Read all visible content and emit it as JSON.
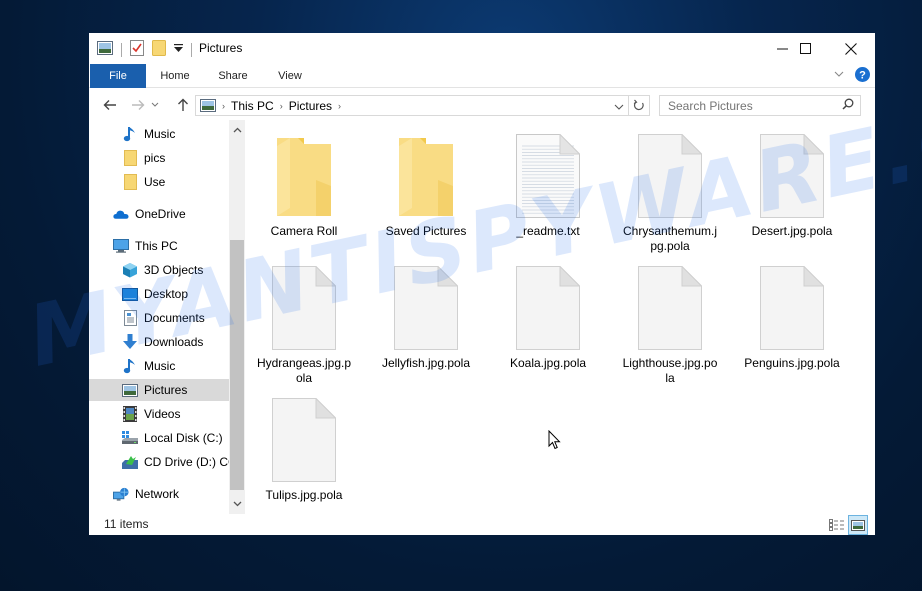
{
  "window": {
    "title": "Pictures",
    "controls": {
      "minimize": "minimize",
      "maximize": "maximize",
      "close": "close"
    }
  },
  "ribbon": {
    "tabs": [
      {
        "label": "File",
        "active": true
      },
      {
        "label": "Home"
      },
      {
        "label": "Share"
      },
      {
        "label": "View"
      }
    ]
  },
  "navbar": {
    "breadcrumb": [
      "This PC",
      "Pictures"
    ],
    "search_placeholder": "Search Pictures"
  },
  "sidebar": {
    "items": [
      {
        "label": "Music",
        "icon": "music-icon",
        "indent": 2
      },
      {
        "label": "pics",
        "icon": "folder-icon",
        "indent": 2
      },
      {
        "label": "Use",
        "icon": "folder-icon",
        "indent": 2
      },
      {
        "label": "OneDrive",
        "icon": "onedrive-icon",
        "indent": 1
      },
      {
        "label": "This PC",
        "icon": "this-pc-icon",
        "indent": 1
      },
      {
        "label": "3D Objects",
        "icon": "3d-objects-icon",
        "indent": 2
      },
      {
        "label": "Desktop",
        "icon": "desktop-icon",
        "indent": 2
      },
      {
        "label": "Documents",
        "icon": "documents-icon",
        "indent": 2
      },
      {
        "label": "Downloads",
        "icon": "downloads-icon",
        "indent": 2
      },
      {
        "label": "Music",
        "icon": "music-icon",
        "indent": 2
      },
      {
        "label": "Pictures",
        "icon": "pictures-icon",
        "indent": 2,
        "selected": true
      },
      {
        "label": "Videos",
        "icon": "videos-icon",
        "indent": 2
      },
      {
        "label": "Local Disk (C:)",
        "icon": "local-disk-icon",
        "indent": 2
      },
      {
        "label": "CD Drive (D:) CC",
        "icon": "cd-drive-icon",
        "indent": 2
      },
      {
        "label": "Network",
        "icon": "network-icon",
        "indent": 1
      }
    ]
  },
  "files": [
    {
      "name": "Camera Roll",
      "type": "folder"
    },
    {
      "name": "Saved Pictures",
      "type": "folder"
    },
    {
      "name": "_readme.txt",
      "type": "text"
    },
    {
      "name": "Chrysanthemum.jpg.pola",
      "type": "blank"
    },
    {
      "name": "Desert.jpg.pola",
      "type": "blank"
    },
    {
      "name": "Hydrangeas.jpg.pola",
      "type": "blank"
    },
    {
      "name": "Jellyfish.jpg.pola",
      "type": "blank"
    },
    {
      "name": "Koala.jpg.pola",
      "type": "blank"
    },
    {
      "name": "Lighthouse.jpg.pola",
      "type": "blank"
    },
    {
      "name": "Penguins.jpg.pola",
      "type": "blank"
    },
    {
      "name": "Tulips.jpg.pola",
      "type": "blank"
    }
  ],
  "status": {
    "item_count": "11 items"
  },
  "watermark": "MYANTISPYWARE.COM",
  "colors": {
    "file_tab": "#1a5fad",
    "selected_nav": "#d9d9d9",
    "folder": "#f7d774"
  }
}
